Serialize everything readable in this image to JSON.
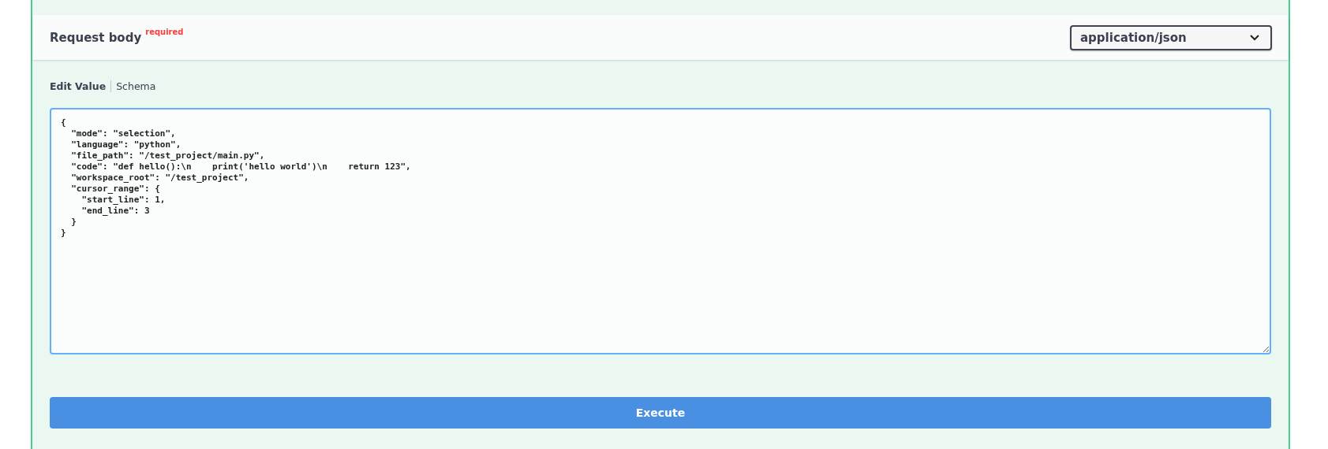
{
  "request_body": {
    "title": "Request body",
    "required_badge": "required",
    "content_type": "application/json"
  },
  "tabs": [
    {
      "label": "Edit Value",
      "selected": true
    },
    {
      "label": "Schema",
      "selected": false
    }
  ],
  "editor": {
    "value": "{\n  \"mode\": \"selection\",\n  \"language\": \"python\",\n  \"file_path\": \"/test_project/main.py\",\n  \"code\": \"def hello():\\n    print('hello world')\\n    return 123\",\n  \"workspace_root\": \"/test_project\",\n  \"cursor_range\": {\n    \"start_line\": 1,\n    \"end_line\": 3\n  }\n}"
  },
  "execute_button": "Execute"
}
